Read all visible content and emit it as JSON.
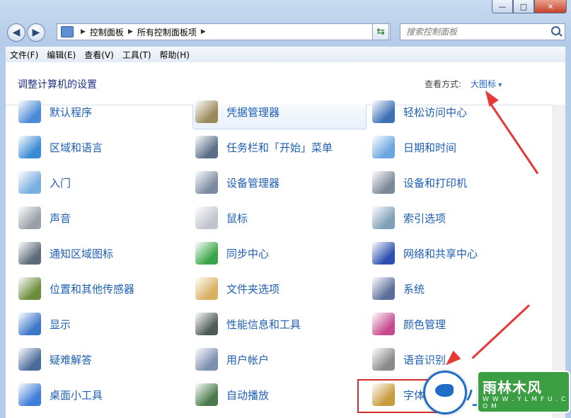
{
  "window": {
    "caption": {
      "minimize": "—",
      "maximize": "□",
      "close": "✕"
    }
  },
  "address": {
    "breadcrumb": [
      "控制面板",
      "所有控制面板项"
    ],
    "search_placeholder": "搜索控制面板"
  },
  "menu": [
    "文件(F)",
    "编辑(E)",
    "查看(V)",
    "工具(T)",
    "帮助(H)"
  ],
  "header": {
    "title": "调整计算机的设置",
    "view_label": "查看方式:",
    "view_value": "大图标"
  },
  "items": [
    {
      "label": "默认程序",
      "icon": "default-programs-icon"
    },
    {
      "label": "凭据管理器",
      "icon": "credential-manager-icon"
    },
    {
      "label": "轻松访问中心",
      "icon": "ease-of-access-icon"
    },
    {
      "label": "区域和语言",
      "icon": "globe-icon"
    },
    {
      "label": "任务栏和「开始」菜单",
      "icon": "taskbar-icon"
    },
    {
      "label": "日期和时间",
      "icon": "calendar-icon"
    },
    {
      "label": "入门",
      "icon": "getting-started-icon"
    },
    {
      "label": "设备管理器",
      "icon": "device-manager-icon"
    },
    {
      "label": "设备和打印机",
      "icon": "printer-icon"
    },
    {
      "label": "声音",
      "icon": "speaker-icon"
    },
    {
      "label": "鼠标",
      "icon": "mouse-icon"
    },
    {
      "label": "索引选项",
      "icon": "index-options-icon"
    },
    {
      "label": "通知区域图标",
      "icon": "notification-icon"
    },
    {
      "label": "同步中心",
      "icon": "sync-icon"
    },
    {
      "label": "网络和共享中心",
      "icon": "network-icon"
    },
    {
      "label": "位置和其他传感器",
      "icon": "location-sensor-icon"
    },
    {
      "label": "文件夹选项",
      "icon": "folder-options-icon"
    },
    {
      "label": "系统",
      "icon": "system-icon"
    },
    {
      "label": "显示",
      "icon": "display-icon"
    },
    {
      "label": "性能信息和工具",
      "icon": "performance-icon"
    },
    {
      "label": "颜色管理",
      "icon": "color-management-icon"
    },
    {
      "label": "疑难解答",
      "icon": "troubleshooting-icon"
    },
    {
      "label": "用户帐户",
      "icon": "user-accounts-icon"
    },
    {
      "label": "语音识别",
      "icon": "microphone-icon"
    },
    {
      "label": "桌面小工具",
      "icon": "gadgets-icon"
    },
    {
      "label": "自动播放",
      "icon": "autoplay-icon"
    },
    {
      "label": "字体",
      "icon": "fonts-icon"
    }
  ],
  "watermark": {
    "xiao": "小",
    "brand": "雨林木风",
    "url": "W W W . Y L M F U . C O M"
  },
  "colors": {
    "link": "#1e5fb4",
    "title": "#1e3287",
    "accent_red": "#d72a2a",
    "brand_green": "#3c9e43"
  }
}
